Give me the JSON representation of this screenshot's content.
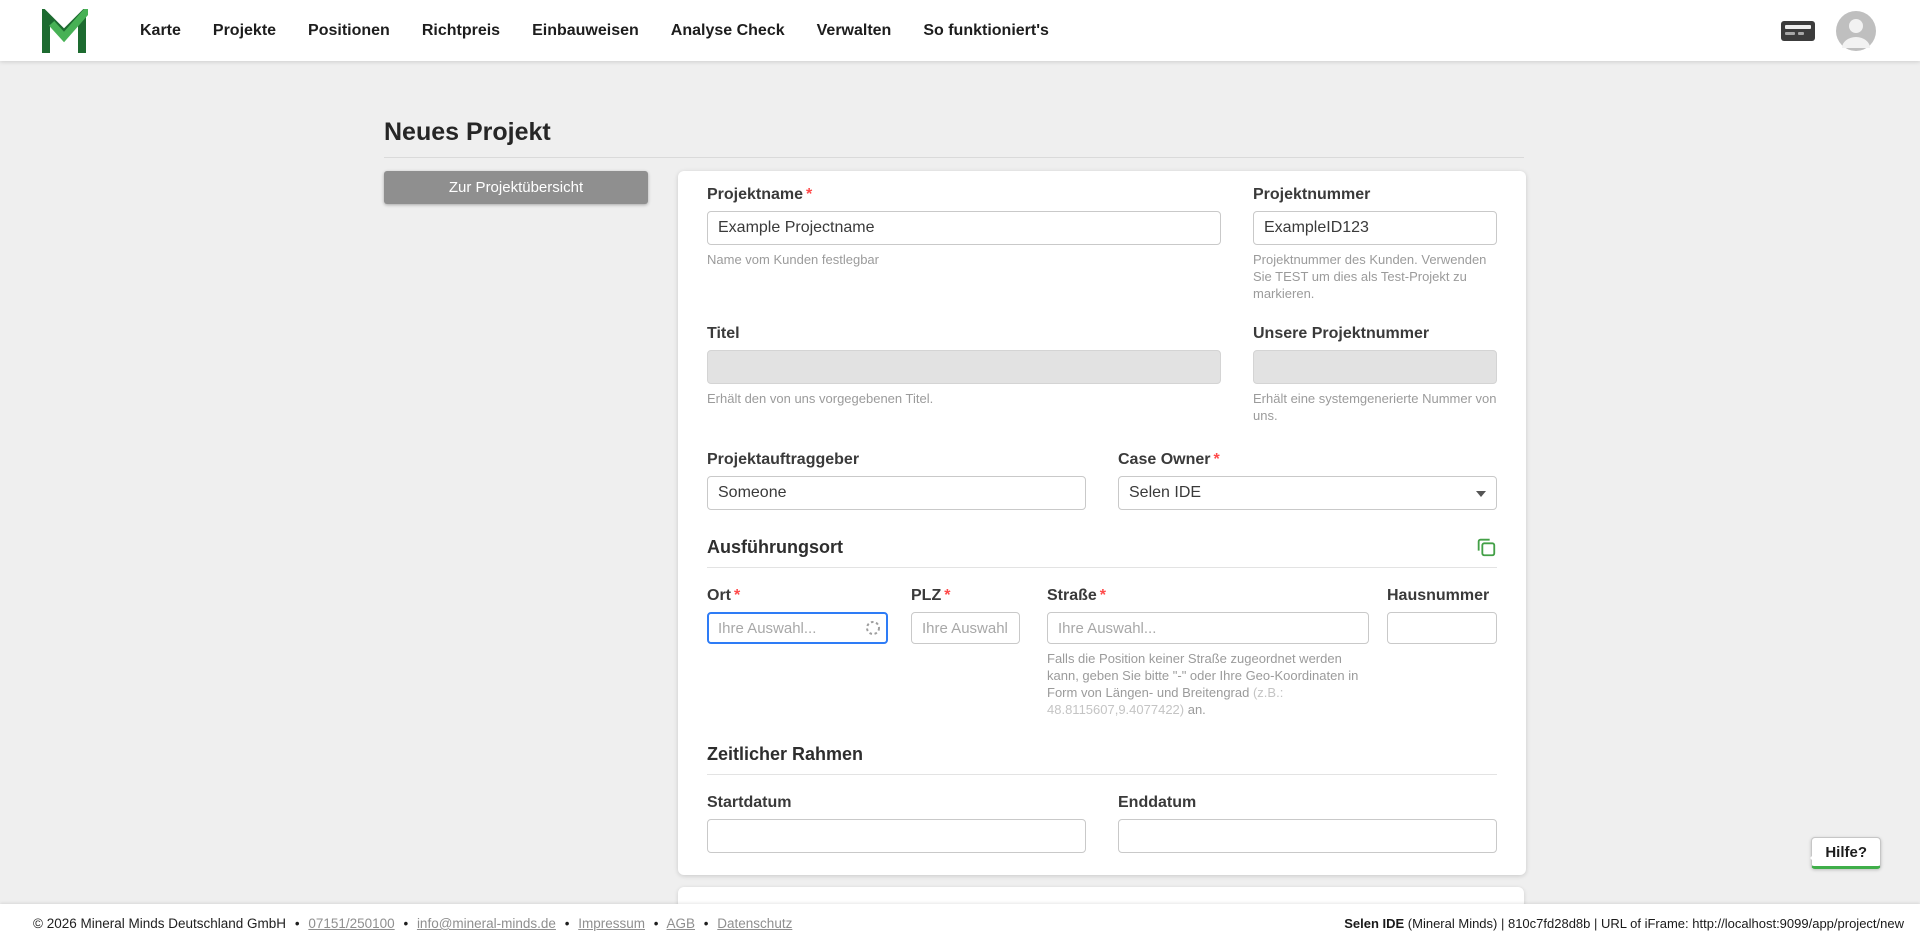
{
  "ui": {
    "required_marker": "*"
  },
  "colors": {
    "brand_green": "#3fae49",
    "focus_blue": "#2e7cf6",
    "required_red": "#ff4a4a",
    "button_gray": "#8f8f8f"
  },
  "nav": {
    "items": [
      "Karte",
      "Projekte",
      "Positionen",
      "Richtpreis",
      "Einbauweisen",
      "Analyse Check",
      "Verwalten",
      "So funktioniert's"
    ],
    "icons": {
      "left": "mineral-minds-logo",
      "right": [
        "card-terminal-icon",
        "user-avatar-icon"
      ]
    }
  },
  "page": {
    "title": "Neues Projekt",
    "back_button": "Zur Projektübersicht",
    "help": "Hilfe?"
  },
  "form": {
    "projektname": {
      "label": "Projektname",
      "value": "Example Projectname",
      "hint": "Name vom Kunden festlegbar"
    },
    "projektnummer": {
      "label": "Projektnummer",
      "value": "ExampleID123",
      "hint": "Projektnummer des Kunden. Verwenden Sie TEST um dies als Test-Projekt zu markieren."
    },
    "titel": {
      "label": "Titel",
      "value": "",
      "hint": "Erhält den von uns vorgegebenen Titel."
    },
    "unsere_projektnummer": {
      "label": "Unsere Projektnummer",
      "value": "",
      "hint": "Erhält eine systemgenerierte Nummer von uns."
    },
    "projektauftraggeber": {
      "label": "Projektauftraggeber",
      "value": "Someone"
    },
    "case_owner": {
      "label": "Case Owner",
      "value": "Selen IDE"
    },
    "sections": {
      "ausfuehrungsort": "Ausführungsort",
      "zeitlicher_rahmen": "Zeitlicher Rahmen"
    },
    "ort": {
      "label": "Ort",
      "placeholder": "Ihre Auswahl..."
    },
    "plz": {
      "label": "PLZ",
      "placeholder": "Ihre Auswahl."
    },
    "strasse": {
      "label": "Straße",
      "placeholder": "Ihre Auswahl...",
      "hint_main": "Falls die Position keiner Straße zugeordnet werden kann, geben Sie bitte \"-\" oder Ihre Geo-Koordinaten in Form von Längen- und Breitengrad ",
      "hint_example": "(z.B.: 48.8115607,9.4077422)",
      "hint_suffix": " an."
    },
    "hausnummer": {
      "label": "Hausnummer",
      "value": ""
    },
    "startdatum": {
      "label": "Startdatum",
      "value": ""
    },
    "enddatum": {
      "label": "Enddatum",
      "value": ""
    }
  },
  "footer": {
    "copyright": "© 2026 Mineral Minds Deutschland GmbH",
    "separator": "•",
    "links": [
      "07151/250100",
      "info@mineral-minds.de",
      "Impressum",
      "AGB",
      "Datenschutz"
    ],
    "session_bold": "Selen IDE",
    "session_rest": " (Mineral Minds) | 810c7fd28d8b | URL of iFrame: http://localhost:9099/app/project/new"
  }
}
